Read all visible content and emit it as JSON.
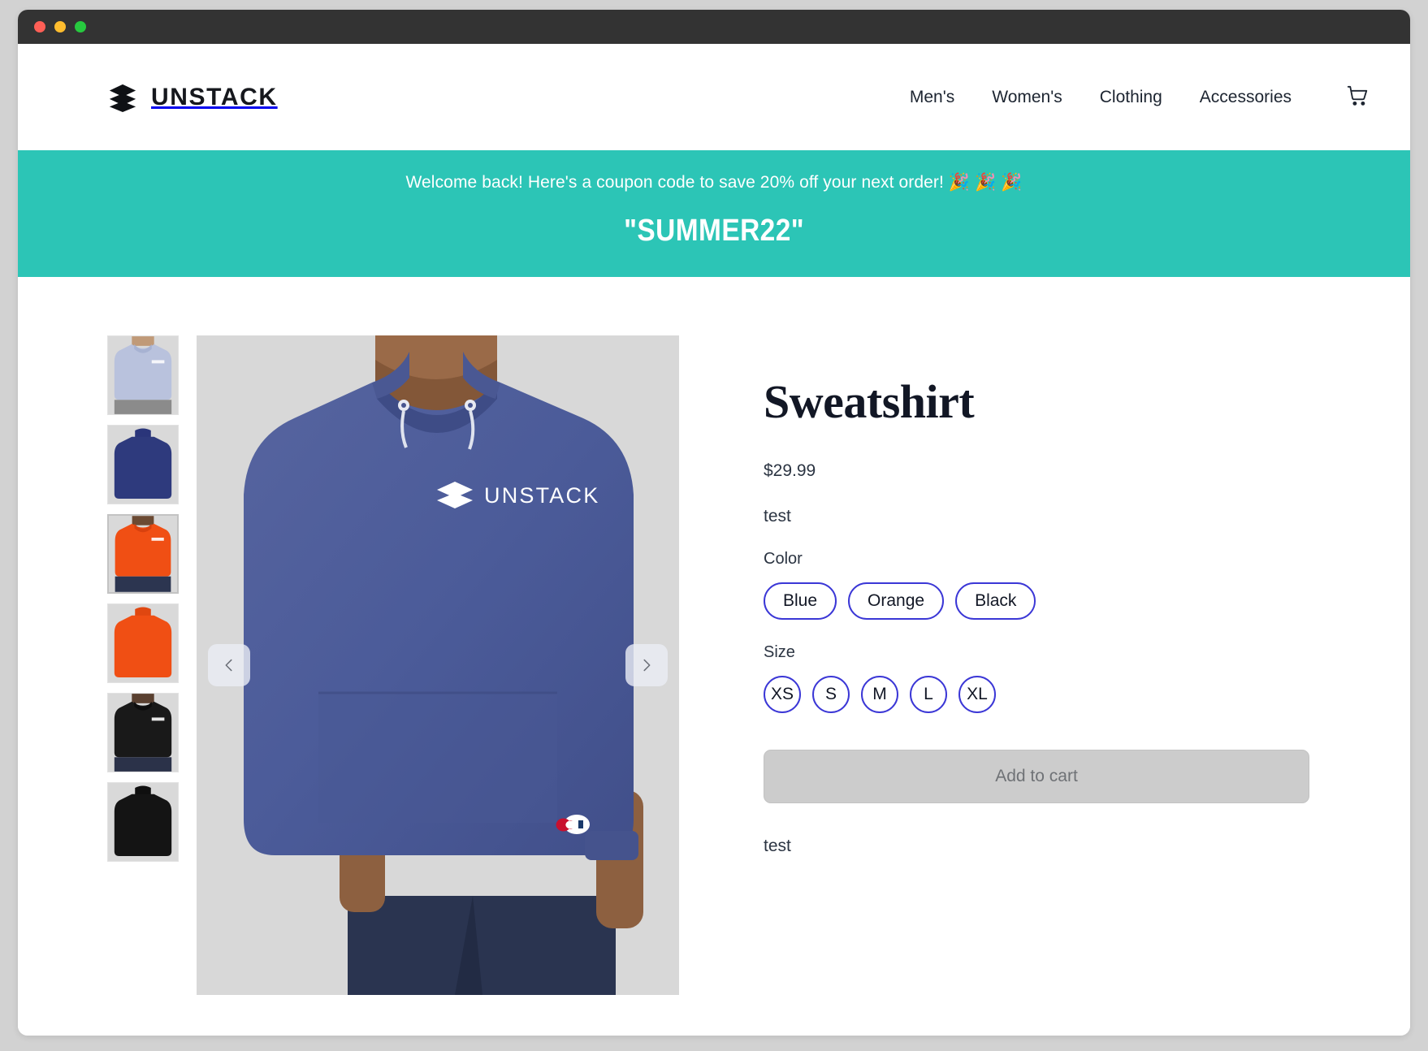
{
  "window": {
    "traffic_lights": [
      "close-red",
      "minimize-yellow",
      "maximize-green"
    ]
  },
  "header": {
    "brand_name": "UNSTACK",
    "brand_icon": "stacked-layers-icon",
    "nav": [
      {
        "label": "Men's"
      },
      {
        "label": "Women's"
      },
      {
        "label": "Clothing"
      },
      {
        "label": "Accessories"
      }
    ],
    "cart_icon": "shopping-cart-icon"
  },
  "promo": {
    "message": "Welcome back! Here's a coupon code to save 20% off your next order! 🎉 🎉 🎉",
    "code": "\"SUMMER22\"",
    "background_color": "#2cc5b6",
    "text_color": "#ffffff"
  },
  "gallery": {
    "selected_index": 2,
    "thumbnails": [
      {
        "alt": "Light blue heather hoodie front",
        "color": "#b9c2dd",
        "view": "front"
      },
      {
        "alt": "Navy blue hoodie back",
        "color": "#2e3a7d",
        "view": "back"
      },
      {
        "alt": "Orange hoodie front",
        "color": "#f04f14",
        "view": "front"
      },
      {
        "alt": "Orange hoodie back",
        "color": "#f04f14",
        "view": "back"
      },
      {
        "alt": "Black hoodie front",
        "color": "#191919",
        "view": "front"
      },
      {
        "alt": "Black hoodie back",
        "color": "#141414",
        "view": "back"
      }
    ],
    "hero": {
      "alt": "Model wearing blue heather Champion hoodie with UNSTACK chest logo",
      "chest_logo_text": "UNSTACK",
      "background_color": "#d8d8d8",
      "garment_color": "#4e5ea4"
    },
    "prev_label": "‹",
    "next_label": "›",
    "prev_icon": "chevron-left-icon",
    "next_icon": "chevron-right-icon"
  },
  "product": {
    "title": "Sweatshirt",
    "price": "$29.99",
    "description": "test",
    "footer_note": "test",
    "accent_color": "#3b37d6",
    "options": [
      {
        "label": "Color",
        "values": [
          {
            "label": "Blue"
          },
          {
            "label": "Orange"
          },
          {
            "label": "Black"
          }
        ]
      },
      {
        "label": "Size",
        "values": [
          {
            "label": "XS"
          },
          {
            "label": "S"
          },
          {
            "label": "M"
          },
          {
            "label": "L"
          },
          {
            "label": "XL"
          }
        ]
      }
    ],
    "add_to_cart_label": "Add to cart",
    "add_to_cart_disabled": true
  }
}
